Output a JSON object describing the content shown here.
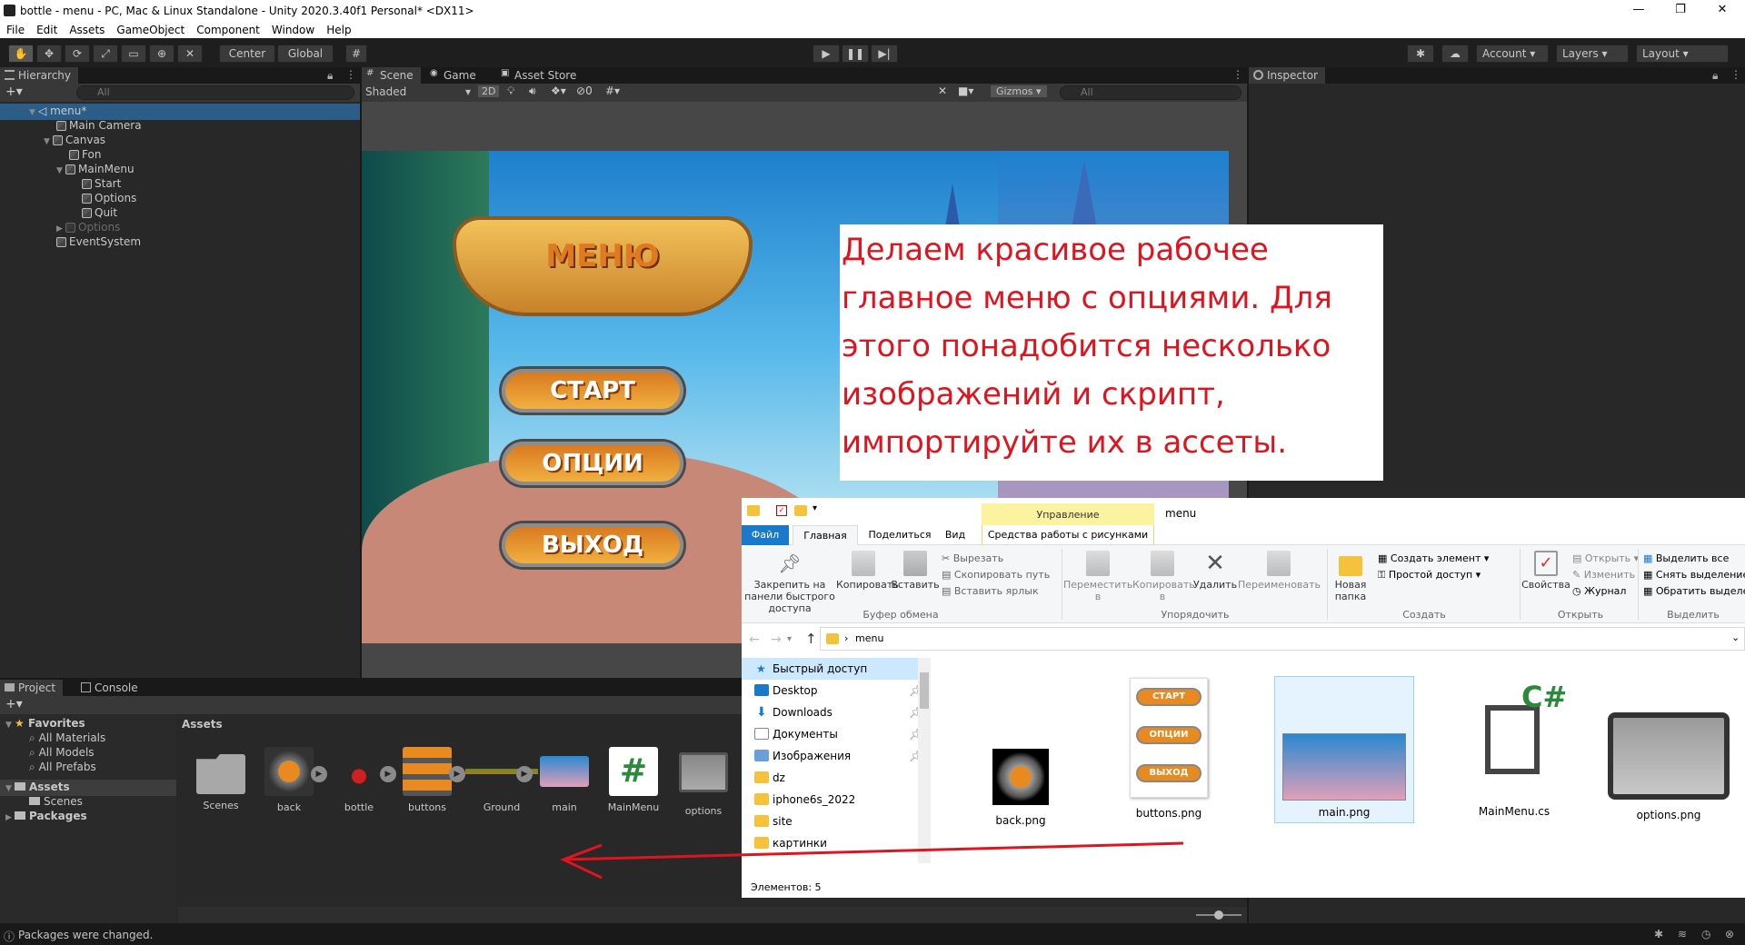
{
  "window": {
    "title": "bottle - menu - PC, Mac & Linux Standalone - Unity 2020.3.40f1 Personal* <DX11>",
    "controls": [
      "—",
      "❐",
      "✕"
    ]
  },
  "menubar": [
    "File",
    "Edit",
    "Assets",
    "GameObject",
    "Component",
    "Window",
    "Help"
  ],
  "toolbar": {
    "center_label": "Center",
    "global_label": "Global",
    "account_label": "Account",
    "layers_label": "Layers",
    "layout_label": "Layout"
  },
  "hierarchy": {
    "tab": "Hierarchy",
    "search_placeholder": "All",
    "items": [
      "menu*",
      "Main Camera",
      "Canvas",
      "Fon",
      "MainMenu",
      "Start",
      "Options",
      "Quit",
      "Options",
      "EventSystem"
    ]
  },
  "scene": {
    "tabs": [
      "Scene",
      "Game",
      "Asset Store"
    ],
    "shading": "Shaded",
    "mode_2d": "2D",
    "hidden_count": "0",
    "gizmos_label": "Gizmos",
    "search_placeholder": "All",
    "game_title": "МЕНЮ",
    "game_buttons": [
      "СТАРТ",
      "ОПЦИИ",
      "ВЫХОД"
    ]
  },
  "inspector": {
    "tab": "Inspector"
  },
  "annotation": {
    "text": "Делаем красивое рабочее главное меню с опциями. Для этого понадобится несколько изображений и скрипт, импортируйте их в ассеты."
  },
  "project": {
    "tabs": [
      "Project",
      "Console"
    ],
    "favorites_label": "Favorites",
    "favorites": [
      "All Materials",
      "All Models",
      "All Prefabs"
    ],
    "assets_label": "Assets",
    "assets_children": [
      "Scenes"
    ],
    "packages_label": "Packages",
    "breadcrumb": "Assets",
    "items": [
      "Scenes",
      "back",
      "bottle",
      "buttons",
      "Ground",
      "main",
      "MainMenu",
      "options"
    ]
  },
  "statusbar": {
    "text": "Packages were changed."
  },
  "explorer": {
    "manage_label": "Управление",
    "folder_title": "menu",
    "tabs": [
      "Файл",
      "Главная",
      "Поделиться",
      "Вид",
      "Средства работы с рисунками"
    ],
    "ribbon": {
      "pin_label": "Закрепить на панели быстрого доступа",
      "copy_label": "Копировать",
      "paste_label": "Вставить",
      "cut_label": "Вырезать",
      "copy_path_label": "Скопировать путь",
      "paste_shortcut_label": "Вставить ярлык",
      "clipboard_group": "Буфер обмена",
      "move_label": "Переместить в",
      "copyto_label": "Копировать в",
      "delete_label": "Удалить",
      "rename_label": "Переименовать",
      "organize_group": "Упорядочить",
      "new_folder_label": "Новая папка",
      "new_item_label": "Создать элемент",
      "easy_access_label": "Простой доступ",
      "create_group": "Создать",
      "properties_label": "Свойства",
      "open_label": "Открыть",
      "edit_label": "Изменить",
      "history_label": "Журнал",
      "open_group": "Открыть",
      "select_all_label": "Выделить все",
      "select_none_label": "Снять выделение",
      "invert_label": "Обратить выделение",
      "select_group": "Выделить"
    },
    "address": "menu",
    "sidebar": [
      "Быстрый доступ",
      "Desktop",
      "Downloads",
      "Документы",
      "Изображения",
      "dz",
      "iphone6s_2022",
      "site",
      "картинки"
    ],
    "files": [
      "back.png",
      "buttons.png",
      "main.png",
      "MainMenu.cs",
      "options.png"
    ],
    "file_buttons": [
      "СТАРТ",
      "ОПЦИИ",
      "ВЫХОД"
    ],
    "status": "Элементов: 5"
  },
  "colors": {
    "annotation_text": "#e0141e",
    "arrow": "#e0141e",
    "unity_bg": "#282828",
    "explorer_accent": "#1979ca"
  }
}
